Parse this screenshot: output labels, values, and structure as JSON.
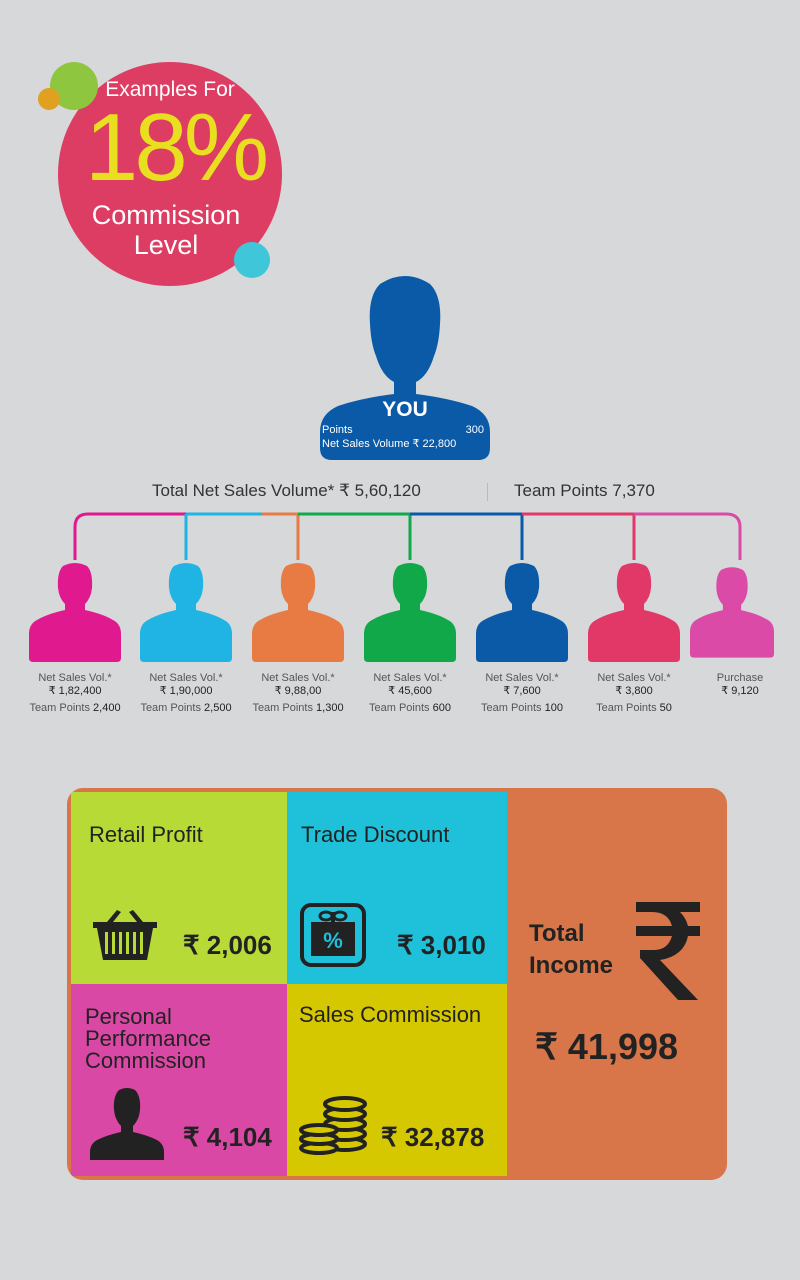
{
  "badge": {
    "line1": "Examples For",
    "percent": "18%",
    "line3": "Commission",
    "line4": "Level"
  },
  "you": {
    "title": "YOU",
    "points_label": "Points",
    "points_value": "300",
    "net_sales": "Net Sales  Volume ₹ 22,800",
    "color": "#0b5aa8"
  },
  "summary": {
    "total_net_sales": "Total Net Sales Volume* ₹  5,60,120",
    "team_points": "Team Points 7,370"
  },
  "members": [
    {
      "label": "Net Sales Vol.*",
      "value": "₹ 1,82,400",
      "team_label": "Team Points",
      "team_value": "2,400",
      "color": "#e0198f"
    },
    {
      "label": "Net Sales Vol.*",
      "value": "₹ 1,90,000",
      "team_label": "Team Points",
      "team_value": "2,500",
      "color": "#1fb4e3"
    },
    {
      "label": "Net Sales Vol.*",
      "value": "₹ 9,88,00",
      "team_label": "Team Points",
      "team_value": "1,300",
      "color": "#e77b43"
    },
    {
      "label": "Net Sales Vol.*",
      "value": "₹ 45,600",
      "team_label": "Team Points",
      "team_value": "600",
      "color": "#11a849"
    },
    {
      "label": "Net Sales Vol.*",
      "value": "₹ 7,600",
      "team_label": "Team Points",
      "team_value": "100",
      "color": "#0b5aa8"
    },
    {
      "label": "Net Sales Vol.*",
      "value": "₹ 3,800",
      "team_label": "Team Points",
      "team_value": "50",
      "color": "#e23868"
    },
    {
      "label": "Purchase",
      "value": "₹ 9,120",
      "team_label": "",
      "team_value": "",
      "color": "#db4aa6"
    }
  ],
  "income": {
    "retail_profit": {
      "title": "Retail Profit",
      "amount": "₹ 2,006",
      "icon": "basket-icon"
    },
    "trade_discount": {
      "title": "Trade Discount",
      "amount": "₹ 3,010",
      "icon": "discount-gift-icon"
    },
    "personal_commission": {
      "title": "Personal Performance Commission",
      "amount": "₹ 4,104",
      "icon": "person-icon"
    },
    "sales_commission": {
      "title": "Sales Commission",
      "amount": "₹ 32,878",
      "icon": "coins-icon"
    },
    "total": {
      "title": "Total Income",
      "amount": "₹ 41,998",
      "icon": "rupee-icon"
    }
  }
}
